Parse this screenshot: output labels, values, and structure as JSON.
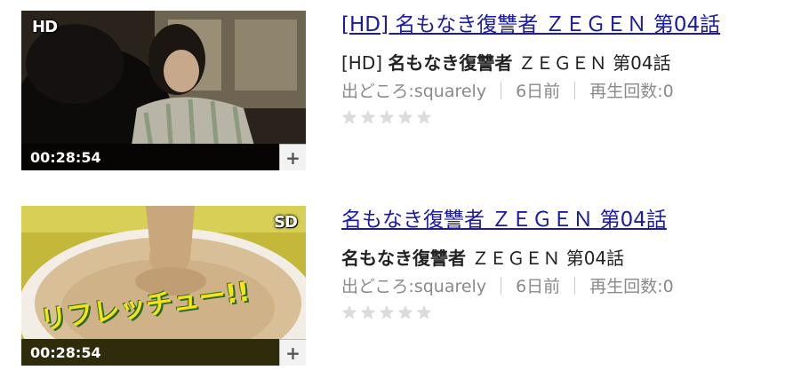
{
  "videos": [
    {
      "quality": "HD",
      "duration": "00:28:54",
      "add_label": "+",
      "title": "[HD] 名もなき復讐者 ＺＥＧＥＮ 第04話",
      "subtitle_prefix": "[HD] ",
      "subtitle_main": "名もなき復讐者",
      "subtitle_rest": " ＺＥＧＥＮ 第04話",
      "source": "出どころ:squarely",
      "age": "6日前",
      "views": "再生回数:0",
      "rating": 0
    },
    {
      "quality": "SD",
      "duration": "00:28:54",
      "add_label": "+",
      "title": "名もなき復讐者 ＺＥＧＥＮ 第04話",
      "subtitle_prefix": "",
      "subtitle_main": "名もなき復讐者",
      "subtitle_rest": " ＺＥＧＥＮ 第04話",
      "source": "出どころ:squarely",
      "age": "6日前",
      "views": "再生回数:0",
      "rating": 0,
      "thumb_text": "リフレッチュー!!"
    }
  ],
  "star_glyph": "★",
  "colors": {
    "link": "#1a1aa6",
    "meta": "#8a8a8a",
    "star_empty": "#dcdcdc"
  }
}
